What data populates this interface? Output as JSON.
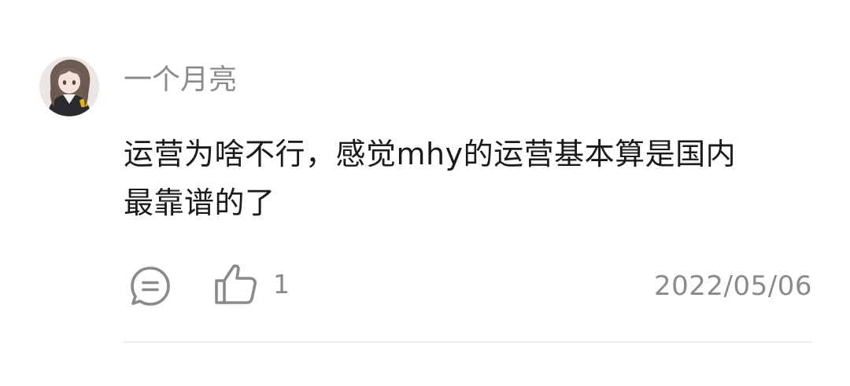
{
  "comment": {
    "username": "一个月亮",
    "content_line1": "运营为啥不行，感觉mhy的运营基本算是国内",
    "content_line2": "最靠谱的了",
    "like_count": "1",
    "date": "2022/05/06"
  },
  "icons": {
    "reply": "chat-bubble-icon",
    "like": "thumbs-up-icon"
  },
  "colors": {
    "secondary_text": "#8a8a8a",
    "primary_text": "#1a1a1a",
    "divider": "#ececec"
  }
}
